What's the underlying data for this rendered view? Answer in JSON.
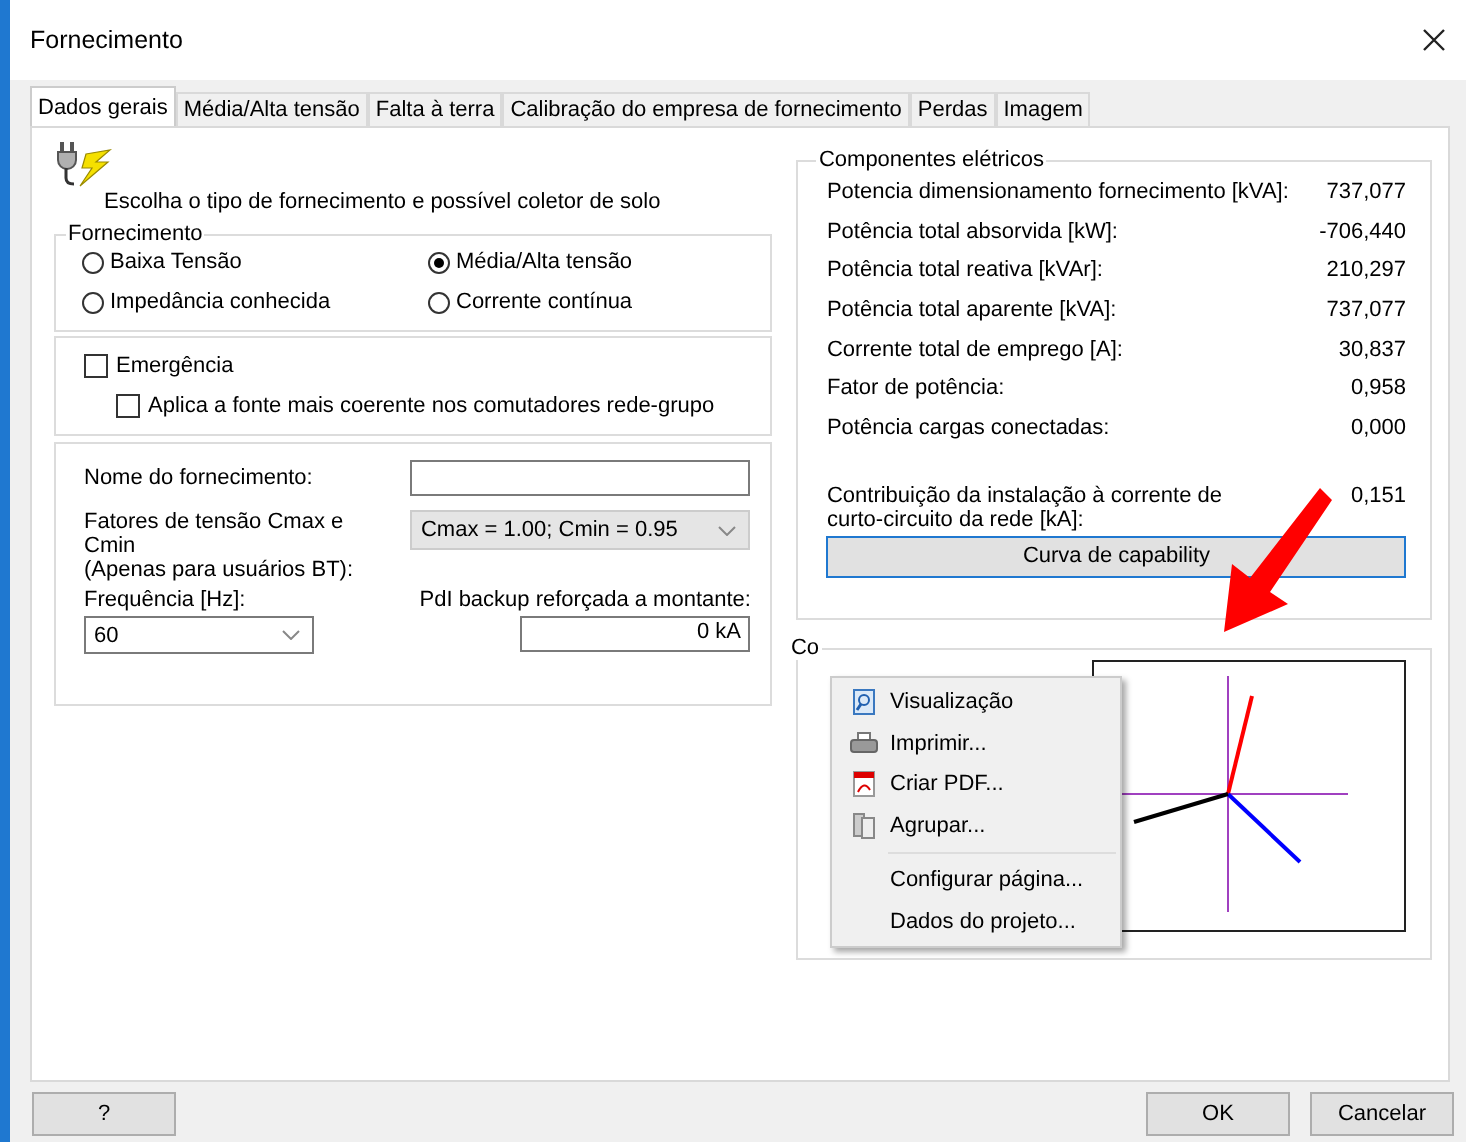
{
  "window": {
    "title": "Fornecimento"
  },
  "tabs": [
    {
      "label": "Dados gerais",
      "selected": true
    },
    {
      "label": "Média/Alta tensão",
      "selected": false
    },
    {
      "label": "Falta à terra",
      "selected": false
    },
    {
      "label": "Calibração do empresa de fornecimento",
      "selected": false
    },
    {
      "label": "Perdas",
      "selected": false
    },
    {
      "label": "Imagem",
      "selected": false
    }
  ],
  "instruction": "Escolha o tipo de fornecimento e possível coletor de solo",
  "supply_group": {
    "title": "Fornecimento",
    "options": [
      {
        "label": "Baixa Tensão",
        "selected": false
      },
      {
        "label": "Média/Alta tensão",
        "selected": true
      },
      {
        "label": "Impedância conhecida",
        "selected": false
      },
      {
        "label": "Corrente contínua",
        "selected": false
      }
    ]
  },
  "emergency": {
    "label": "Emergência",
    "checked": false
  },
  "apply_source": {
    "label": "Aplica a fonte mais coerente nos comutadores rede-grupo",
    "checked": false
  },
  "supply_name": {
    "label": "Nome do fornecimento:"
  },
  "voltage_factors": {
    "label": "Fatores de tensão Cmax e Cmin",
    "note": "(Apenas para usuários BT):",
    "value": "Cmax = 1.00; Cmin = 0.95"
  },
  "frequency": {
    "label": "Frequência [Hz]:",
    "value": "60"
  },
  "backup": {
    "label": "PdI backup reforçada a montante:",
    "value": "0 kA"
  },
  "components": {
    "title": "Componentes elétricos",
    "rows": [
      {
        "label": "Potencia dimensionamento fornecimento [kVA]:",
        "value": "737,077"
      },
      {
        "label": "Potência total absorvida [kW]:",
        "value": "-706,440"
      },
      {
        "label": "Potência total reativa [kVAr]:",
        "value": "210,297"
      },
      {
        "label": "Potência total aparente [kVA]:",
        "value": "737,077"
      },
      {
        "label": "Corrente total de emprego [A]:",
        "value": "30,837"
      },
      {
        "label": "Fator de potência:",
        "value": "0,958"
      },
      {
        "label": "Potência cargas conectadas:",
        "value": "0,000"
      }
    ],
    "contribution": {
      "label": "Contribuição da instalação à corrente de curto-circuito da rede [kA]:",
      "value": "0,151"
    },
    "button": "Curva de capability"
  },
  "diagram_group": {
    "title": "Co"
  },
  "context_menu": [
    {
      "label": "Visualização",
      "separator_before": false
    },
    {
      "label": "Imprimir...",
      "separator_before": false
    },
    {
      "label": "Criar PDF...",
      "separator_before": false
    },
    {
      "label": "Agrupar...",
      "separator_before": false
    },
    {
      "label": "Configurar página...",
      "separator_before": true
    },
    {
      "label": "Dados do projeto...",
      "separator_before": false
    }
  ],
  "buttons": {
    "help": "?",
    "ok": "OK",
    "cancel": "Cancelar"
  }
}
